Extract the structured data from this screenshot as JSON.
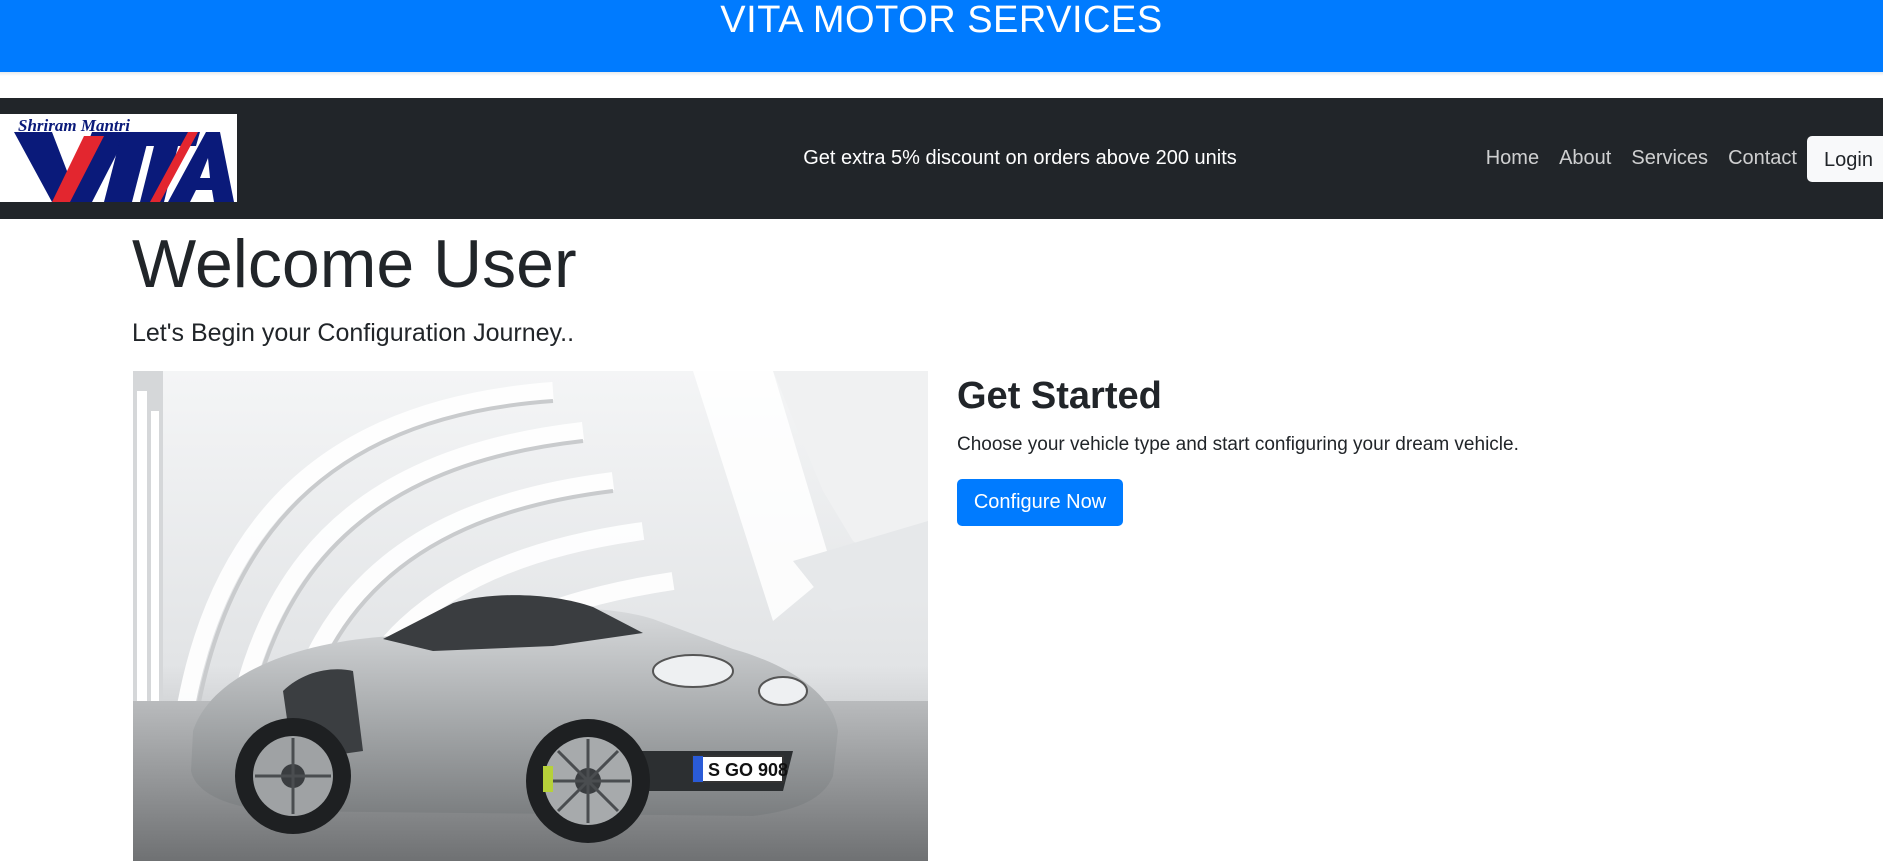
{
  "banner": {
    "title": "VITA MOTOR SERVICES"
  },
  "navbar": {
    "logo": {
      "tagline": "Shriram Mantri",
      "wordmark": "VITA"
    },
    "promo_text": "Get extra 5% discount on orders above 200 units",
    "links": [
      {
        "label": "Home"
      },
      {
        "label": "About"
      },
      {
        "label": "Services"
      },
      {
        "label": "Contact"
      }
    ],
    "login_label": "Login"
  },
  "main": {
    "title": "Welcome User",
    "subtitle": "Let's Begin your Configuration Journey..",
    "image": {
      "icon": "car-photo",
      "plate": "S GO 908"
    },
    "get_started": {
      "title": "Get Started",
      "text": "Choose your vehicle type and start configuring your dream vehicle.",
      "button_label": "Configure Now"
    }
  },
  "colors": {
    "primary": "#007bff",
    "navbar_bg": "#212529",
    "logo_blue": "#0a1a7a",
    "logo_red": "#e3262f"
  }
}
